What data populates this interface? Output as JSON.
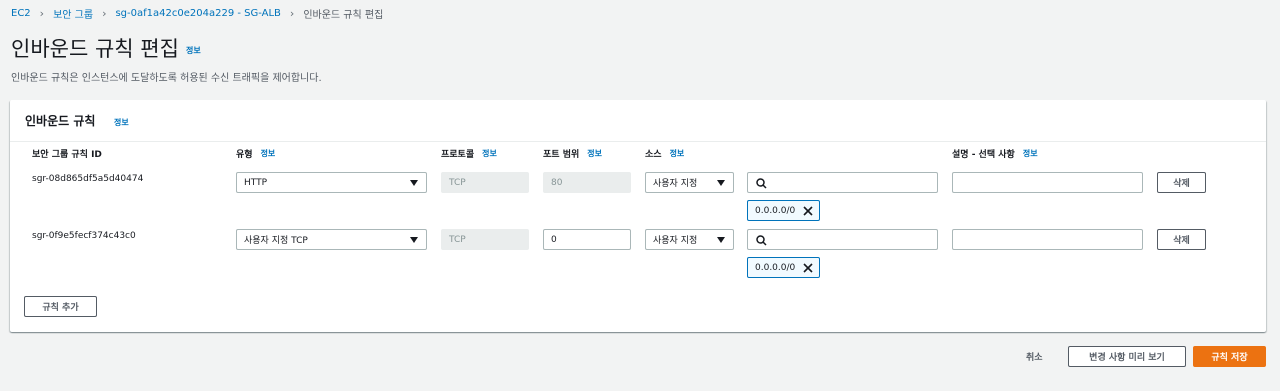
{
  "breadcrumb": {
    "items": [
      "EC2",
      "보안 그룹",
      "sg-0af1a42c0e204a229 - SG-ALB"
    ],
    "current": "인바운드 규칙 편집"
  },
  "page": {
    "title": "인바운드 규칙 편집",
    "info": "정보",
    "description": "인바운드 규칙은 인스턴스에 도달하도록 허용된 수신 트래픽을 제어합니다."
  },
  "panel": {
    "title": "인바운드 규칙",
    "info": "정보",
    "columns": {
      "rule_id": "보안 그룹 규칙 ID",
      "type": "유형",
      "protocol": "프로토콜",
      "port_range": "포트 범위",
      "source": "소스",
      "description": "설명 - 선택 사항",
      "info": "정보"
    },
    "rules": [
      {
        "id": "sgr-08d865df5a5d40474",
        "type": "HTTP",
        "protocol": "TCP",
        "port": "80",
        "source": "사용자 지정",
        "cidr": "0.0.0.0/0",
        "delete": "삭제"
      },
      {
        "id": "sgr-0f9e5fecf374c43c0",
        "type": "사용자 지정 TCP",
        "protocol": "TCP",
        "port": "0",
        "source": "사용자 지정",
        "cidr": "0.0.0.0/0",
        "delete": "삭제"
      }
    ],
    "add_rule": "규칙 추가"
  },
  "footer": {
    "cancel": "취소",
    "preview": "변경 사항 미리 보기",
    "save": "규칙 저장"
  },
  "colors": {
    "link": "#0073bb",
    "primary": "#ec7211",
    "background": "#f2f3f3"
  },
  "icons": [
    "chevron-right-icon",
    "caret-down-icon",
    "search-icon",
    "close-icon"
  ]
}
